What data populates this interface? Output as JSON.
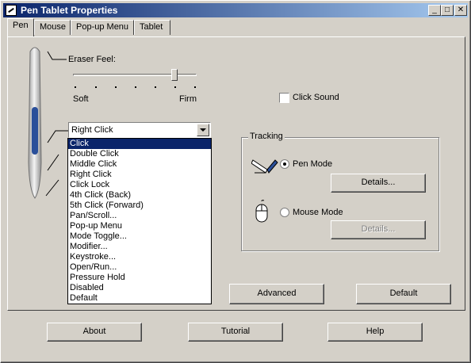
{
  "window": {
    "title": "Pen Tablet Properties"
  },
  "tabs": [
    "Pen",
    "Mouse",
    "Pop-up Menu",
    "Tablet"
  ],
  "eraser": {
    "label": "Eraser Feel:",
    "left_label": "Soft",
    "right_label": "Firm",
    "level": 0.8
  },
  "click_sound": {
    "label": "Click Sound",
    "checked": false
  },
  "button_function": {
    "selected": "Right Click",
    "options": [
      "Click",
      "Double Click",
      "Middle Click",
      "Right Click",
      "Click Lock",
      "4th Click (Back)",
      "5th Click (Forward)",
      "Pan/Scroll...",
      "Pop-up Menu",
      "Mode Toggle...",
      "Modifier...",
      "Keystroke...",
      "Open/Run...",
      "Pressure Hold",
      "Disabled",
      "Default"
    ],
    "highlighted_index": 0
  },
  "tracking": {
    "title": "Tracking",
    "pen_mode": "Pen Mode",
    "mouse_mode": "Mouse Mode",
    "details_label": "Details...",
    "details_disabled_label": "Details..."
  },
  "panel_buttons": {
    "advanced": "Advanced",
    "default": "Default"
  },
  "footer_buttons": {
    "about": "About",
    "tutorial": "Tutorial",
    "help": "Help"
  }
}
